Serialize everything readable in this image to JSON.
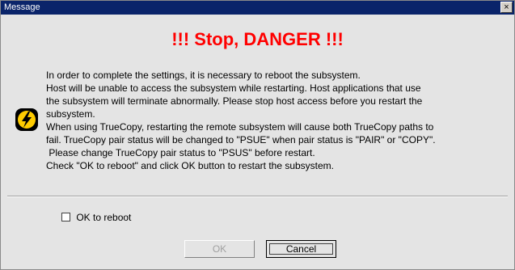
{
  "window": {
    "title": "Message",
    "close_glyph": "×"
  },
  "headline": "!!! Stop, DANGER !!!",
  "icon": "lightning-warning-icon",
  "message_lines": [
    "In order to complete the settings, it is necessary to reboot the subsystem.",
    "Host will be unable to access the subsystem while restarting. Host applications that use",
    "the subsystem will terminate abnormally. Please stop host access before you restart the",
    "subsystem.",
    "When using TrueCopy, restarting the remote subsystem will cause both TrueCopy paths to",
    "fail. TrueCopy pair status will be changed to \"PSUE\" when pair status is \"PAIR\" or \"COPY\".",
    " Please change TrueCopy pair status to \"PSUS\" before restart.",
    "Check \"OK to reboot\" and click OK button to restart the subsystem."
  ],
  "checkbox": {
    "label": "OK to reboot",
    "checked": false
  },
  "buttons": {
    "ok_label": "OK",
    "ok_enabled": false,
    "cancel_label": "Cancel"
  },
  "colors": {
    "headline": "#ff0000",
    "titlebar": "#0a246a",
    "icon_bg": "#000000",
    "icon_bolt": "#ffcc00"
  }
}
